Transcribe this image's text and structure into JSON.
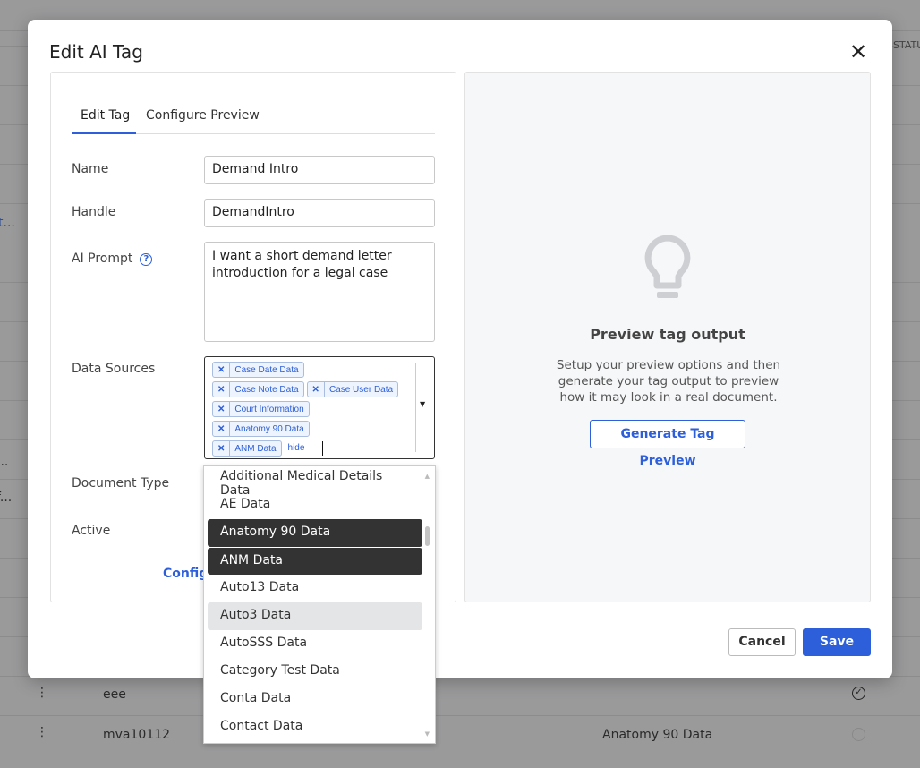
{
  "background": {
    "status_header": "STATUS",
    "left_fragments": [
      "t...",
      "...",
      "f..."
    ],
    "rows": [
      {
        "name": "eee",
        "document_type": "",
        "status_icon": "check-circle-icon"
      },
      {
        "name": "mva10112",
        "document_type": "Anatomy 90 Data",
        "status_icon": "empty-circle-icon"
      }
    ]
  },
  "modal": {
    "title": "Edit AI Tag",
    "close_icon": "close-icon",
    "tabs": [
      {
        "label": "Edit Tag",
        "active": true
      },
      {
        "label": "Configure Preview",
        "active": false
      }
    ],
    "form": {
      "name_label": "Name",
      "name_value": "Demand Intro",
      "handle_label": "Handle",
      "handle_value": "DemandIntro",
      "prompt_label": "AI Prompt",
      "prompt_help": "?",
      "prompt_value": "I want a short demand letter introduction for a legal case",
      "data_sources_label": "Data Sources",
      "data_sources": [
        "Case Date Data",
        "Case Note Data",
        "Case User Data",
        "Court Information",
        "Anatomy 90 Data",
        "ANM Data"
      ],
      "data_sources_input": "hide",
      "document_type_label": "Document Type",
      "active_label": "Active",
      "configure_link": "Configu"
    },
    "dropdown": {
      "options": [
        {
          "label": "Additional Medical Details Data",
          "state": ""
        },
        {
          "label": "AE Data",
          "state": ""
        },
        {
          "label": "Anatomy 90 Data",
          "state": "selected"
        },
        {
          "label": "ANM Data",
          "state": "selected"
        },
        {
          "label": "Auto13 Data",
          "state": ""
        },
        {
          "label": "Auto3 Data",
          "state": "hover"
        },
        {
          "label": "AutoSSS Data",
          "state": ""
        },
        {
          "label": "Category Test Data",
          "state": ""
        },
        {
          "label": "Conta Data",
          "state": ""
        },
        {
          "label": "Contact Data",
          "state": ""
        }
      ]
    },
    "preview": {
      "icon": "lightbulb-icon",
      "heading": "Preview tag output",
      "description": "Setup your preview options and then generate your tag output to preview how it may look in a real document.",
      "button": "Generate Tag Preview"
    },
    "footer": {
      "cancel": "Cancel",
      "save": "Save"
    },
    "colors": {
      "primary": "#2c5fd9",
      "selected_option": "#333333"
    }
  }
}
